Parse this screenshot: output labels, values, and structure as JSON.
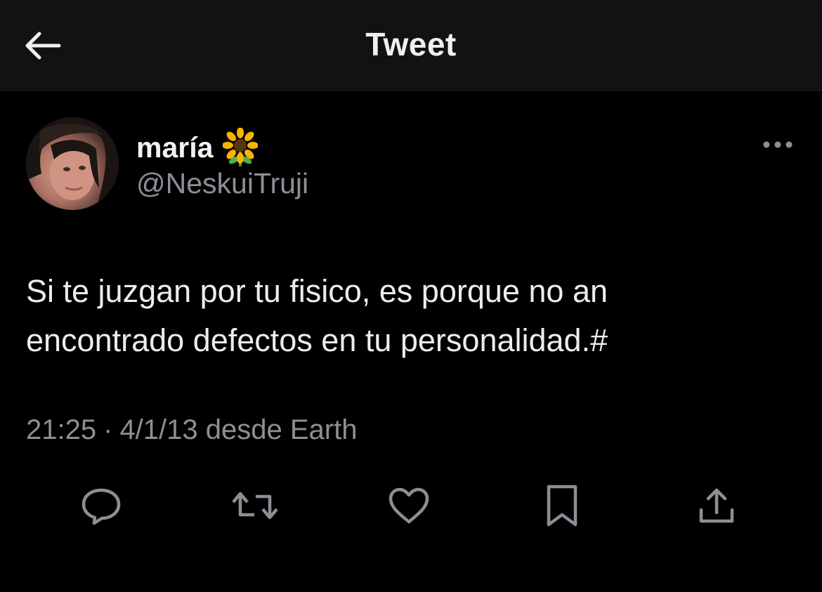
{
  "header": {
    "title": "Tweet",
    "back_icon": "arrow-left-icon"
  },
  "tweet": {
    "author": {
      "display_name": "maría",
      "emoji": "🌻",
      "handle": "@NeskuiTruji"
    },
    "text_line1": "Si te juzgan por tu fisico, es porque no an",
    "text_line2": "encontrado defectos en tu personalidad.#",
    "time": "21:25",
    "separator": "·",
    "date_source": "4/1/13 desde Earth"
  },
  "actions": [
    {
      "name": "reply",
      "icon": "reply-icon"
    },
    {
      "name": "retweet",
      "icon": "retweet-icon"
    },
    {
      "name": "like",
      "icon": "heart-icon"
    },
    {
      "name": "bookmark",
      "icon": "bookmark-icon"
    },
    {
      "name": "share",
      "icon": "share-icon"
    }
  ],
  "colors": {
    "background": "#000000",
    "header_background": "#121212",
    "primary_text": "#e7e9ea",
    "secondary_text": "#8b9096",
    "icon": "#8b9096"
  }
}
